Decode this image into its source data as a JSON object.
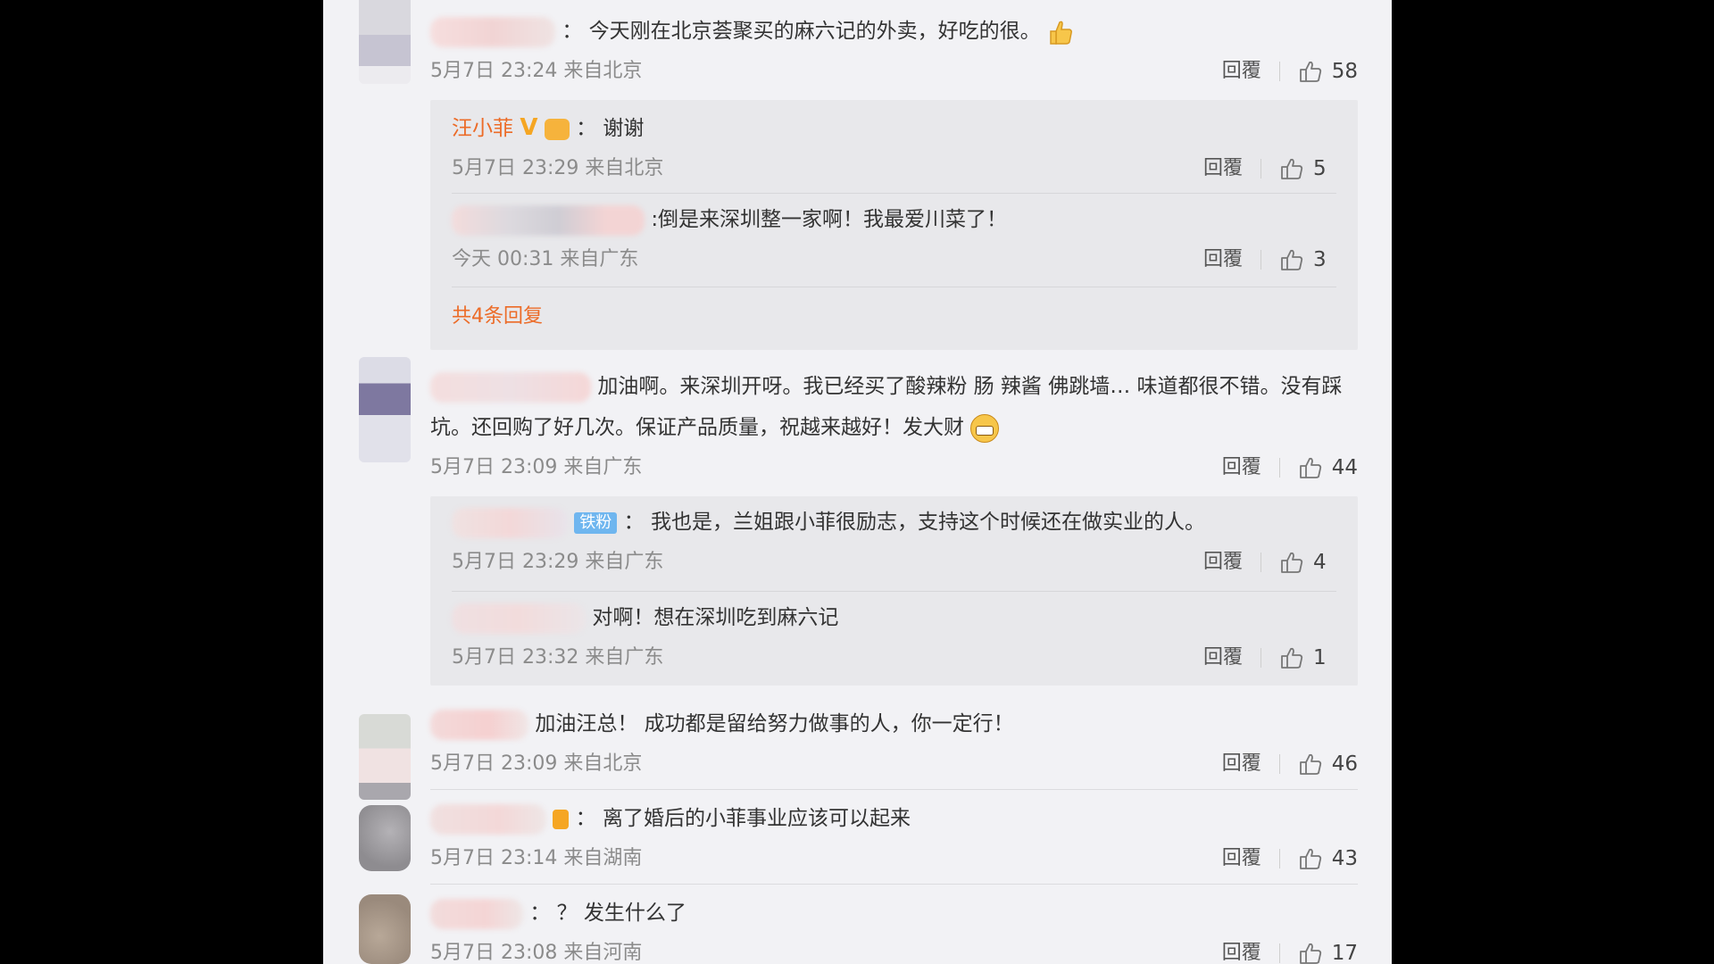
{
  "labels": {
    "reply": "回覆",
    "sep": "："
  },
  "comments": [
    {
      "text": "今天刚在北京荟聚买的麻六记的外卖，好吃的很。",
      "emoji": "thumbs-up-emoji",
      "time": "5月7日 23:24 来自北京",
      "likes": "58",
      "replies": [
        {
          "name": "汪小菲",
          "badge": "V",
          "text": "谢谢",
          "time": "5月7日 23:29 来自北京",
          "likes": "5"
        },
        {
          "text": ":倒是来深圳整一家啊！我最爱川菜了！",
          "time": "今天 00:31 来自广东",
          "likes": "3"
        }
      ],
      "more_replies": "共4条回复"
    },
    {
      "text": "加油啊。来深圳开呀。我已经买了酸辣粉 肠 辣酱 佛跳墙… 味道都很不错。没有踩坑。还回购了好几次。保证产品质量，祝越来越好！发大财",
      "emoji": "grin-emoji",
      "time": "5月7日 23:09 来自广东",
      "likes": "44",
      "replies": [
        {
          "badge": "铁粉",
          "text": "我也是，兰姐跟小菲很励志，支持这个时候还在做实业的人。",
          "time": "5月7日 23:29 来自广东",
          "likes": "4"
        },
        {
          "text": "对啊！想在深圳吃到麻六记",
          "time": "5月7日 23:32 来自广东",
          "likes": "1"
        }
      ]
    },
    {
      "text": "加油汪总！ 成功都是留给努力做事的人，你一定行！",
      "time": "5月7日 23:09 来自北京",
      "likes": "46"
    },
    {
      "text": "离了婚后的小菲事业应该可以起来",
      "time": "5月7日 23:14 来自湖南",
      "likes": "43"
    },
    {
      "text": "？ 发生什么了",
      "time": "5月7日 23:08 来自河南",
      "likes": "17"
    }
  ],
  "colors": {
    "accent": "#ec6b27",
    "panel": "#f2f2f5",
    "reply_bg": "#e8e8eb"
  }
}
